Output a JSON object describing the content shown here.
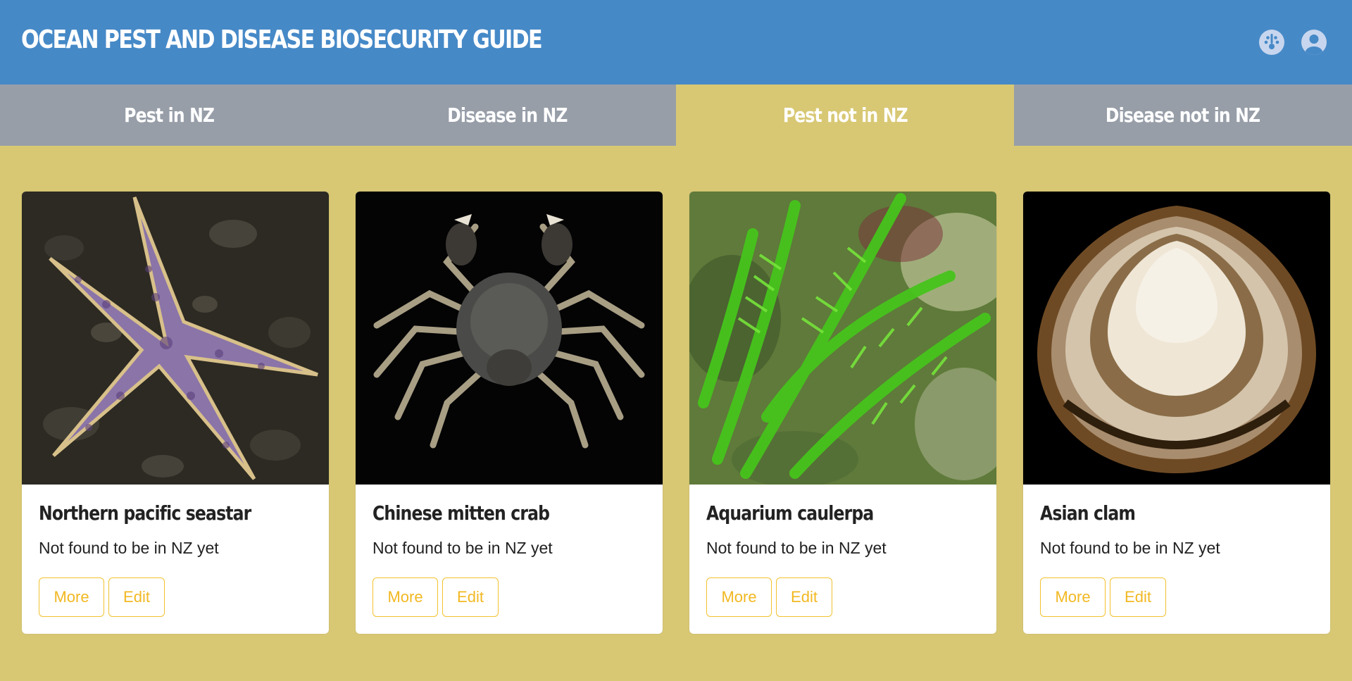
{
  "header": {
    "title": "OCEAN PEST AND DISEASE BIOSECURITY GUIDE",
    "icons": [
      "dashboard-icon",
      "user-account-icon"
    ]
  },
  "tabs": [
    {
      "label": "Pest in NZ",
      "active": false
    },
    {
      "label": "Disease in NZ",
      "active": false
    },
    {
      "label": "Pest not in NZ",
      "active": true
    },
    {
      "label": "Disease not in NZ",
      "active": false
    }
  ],
  "cards": [
    {
      "title": "Northern pacific seastar",
      "status": "Not found to be in NZ yet",
      "more_label": "More",
      "edit_label": "Edit"
    },
    {
      "title": "Chinese mitten crab",
      "status": "Not found to be in NZ yet",
      "more_label": "More",
      "edit_label": "Edit"
    },
    {
      "title": "Aquarium caulerpa",
      "status": "Not found to be in NZ yet",
      "more_label": "More",
      "edit_label": "Edit"
    },
    {
      "title": "Asian clam",
      "status": "Not found to be in NZ yet",
      "more_label": "More",
      "edit_label": "Edit"
    }
  ],
  "colors": {
    "header": "#4689c7",
    "tab_inactive": "#979ea8",
    "background_active": "#d8c874",
    "button_accent": "#f2b822"
  }
}
